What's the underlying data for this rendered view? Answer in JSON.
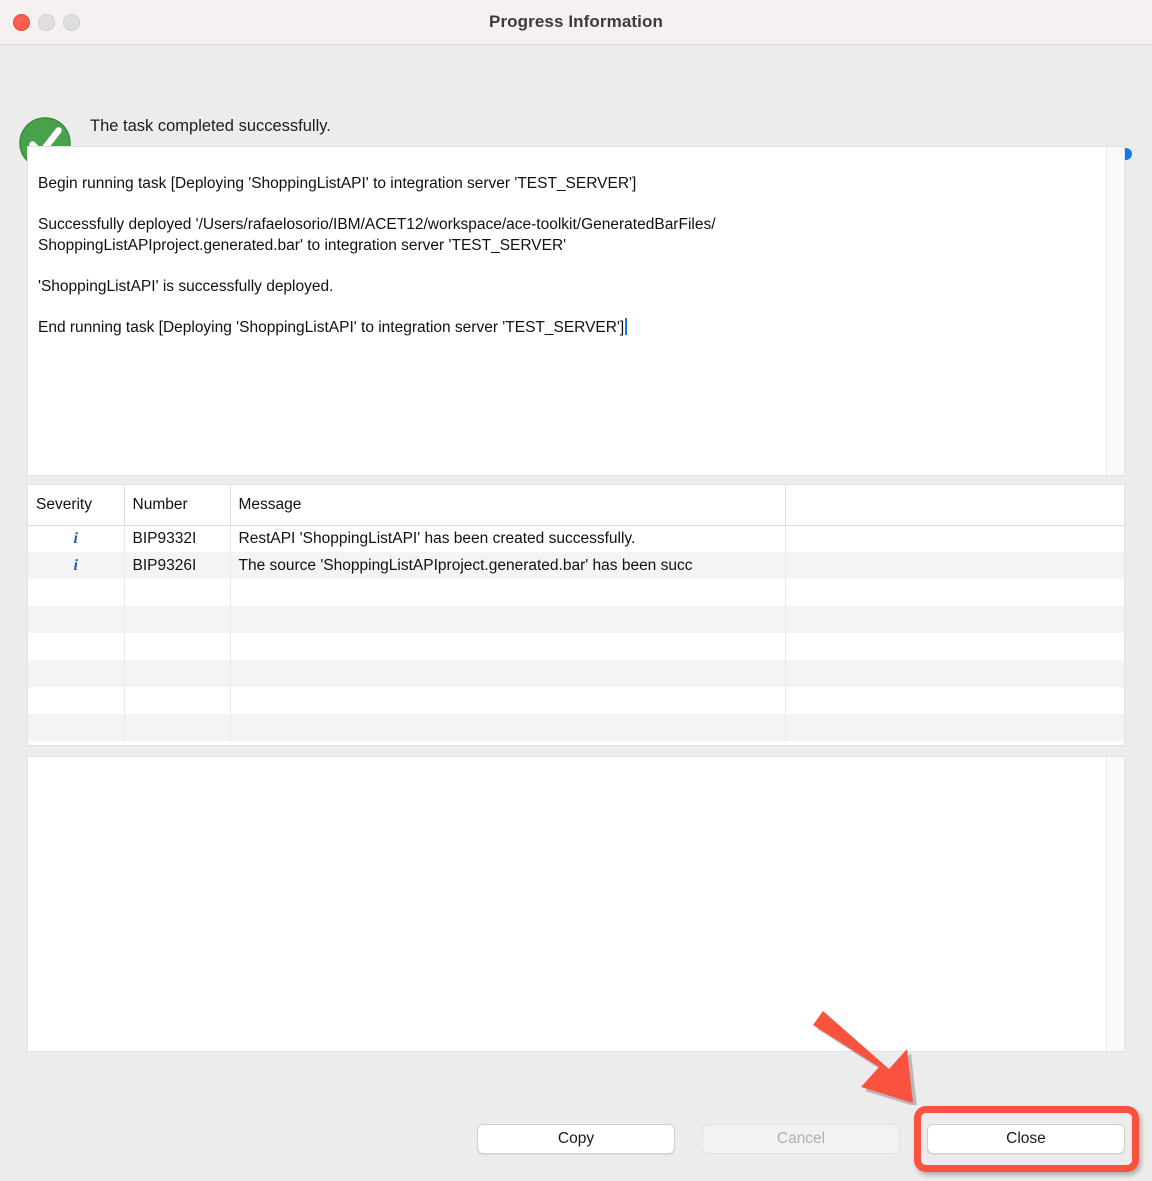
{
  "window": {
    "title": "Progress Information",
    "controls": [
      {
        "name": "close",
        "color": "#fd5e52"
      },
      {
        "name": "minimize",
        "color": "#dedede"
      },
      {
        "name": "maximize",
        "color": "#dedede"
      }
    ]
  },
  "status": {
    "icon": "success-check-icon",
    "message": "The task completed successfully.",
    "progress_percent": 100,
    "progress_color": "#1276f0",
    "success_color": "#43a047"
  },
  "log": {
    "lines": [
      "Begin running task [Deploying 'ShoppingListAPI' to integration server 'TEST_SERVER']",
      "Successfully deployed '/Users/rafaelosorio/IBM/ACET12/workspace/ace-toolkit/GeneratedBarFiles/\nShoppingListAPIproject.generated.bar' to integration server 'TEST_SERVER'",
      "'ShoppingListAPI' is successfully deployed.",
      "End running task [Deploying 'ShoppingListAPI' to integration server 'TEST_SERVER']"
    ]
  },
  "messages_table": {
    "columns": [
      "Severity",
      "Number",
      "Message",
      ""
    ],
    "rows": [
      {
        "severity": "i",
        "number": "BIP9332I",
        "message": "RestAPI 'ShoppingListAPI' has been created successfully."
      },
      {
        "severity": "i",
        "number": "BIP9326I",
        "message": "The source 'ShoppingListAPIproject.generated.bar' has been succ"
      }
    ],
    "empty_row_count": 6
  },
  "details_panel": {
    "content": ""
  },
  "footer": {
    "copy_label": "Copy",
    "cancel_label": "Cancel",
    "close_label": "Close"
  },
  "annotation": {
    "highlight_color": "#f9533f",
    "arrow_target": "close-button"
  }
}
